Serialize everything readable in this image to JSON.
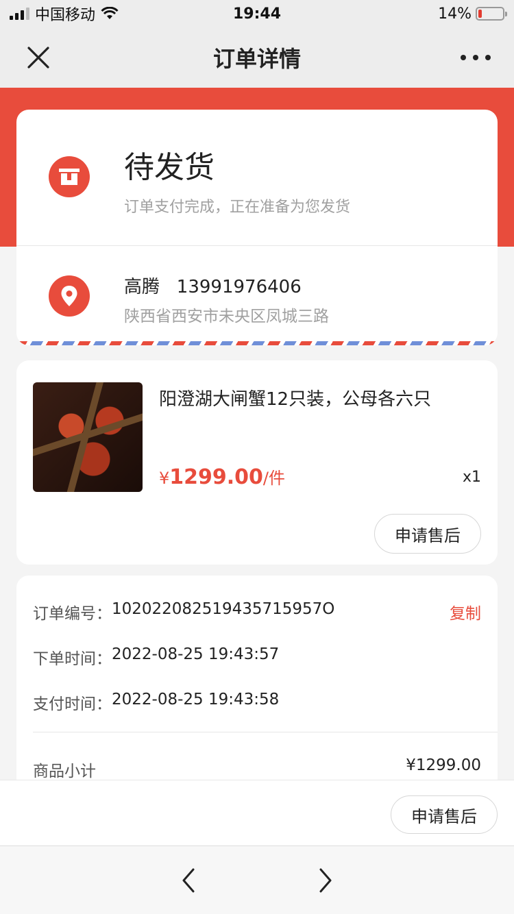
{
  "status_bar": {
    "carrier": "中国移动",
    "time": "19:44",
    "battery_text": "14%",
    "battery_level": 0.14
  },
  "nav": {
    "title": "订单详情"
  },
  "order_status": {
    "title": "待发货",
    "subtitle": "订单支付完成，正在准备为您发货"
  },
  "address": {
    "name_phone": "高腾   13991976406",
    "detail": "陕西省西安市未央区凤城三路"
  },
  "product": {
    "name": "阳澄湖大闸蟹12只装，公母各六只",
    "currency": "¥",
    "price": "1299.00",
    "unit": "/件",
    "qty": "x1",
    "aftersale_label": "申请售后"
  },
  "info": {
    "order_no_label": "订单编号：",
    "order_no": "102022082519435715957O",
    "copy_label": "复制",
    "order_time_label": "下单时间：",
    "order_time": "2022-08-25 19:43:57",
    "pay_time_label": "支付时间：",
    "pay_time": "2022-08-25 19:43:58",
    "subtotal_label": "商品小计",
    "subtotal_value": "¥1299.00"
  },
  "bottom_bar": {
    "aftersale_label": "申请售后"
  },
  "colors": {
    "accent": "#e84c3c",
    "muted_text": "#a0a0a0"
  }
}
